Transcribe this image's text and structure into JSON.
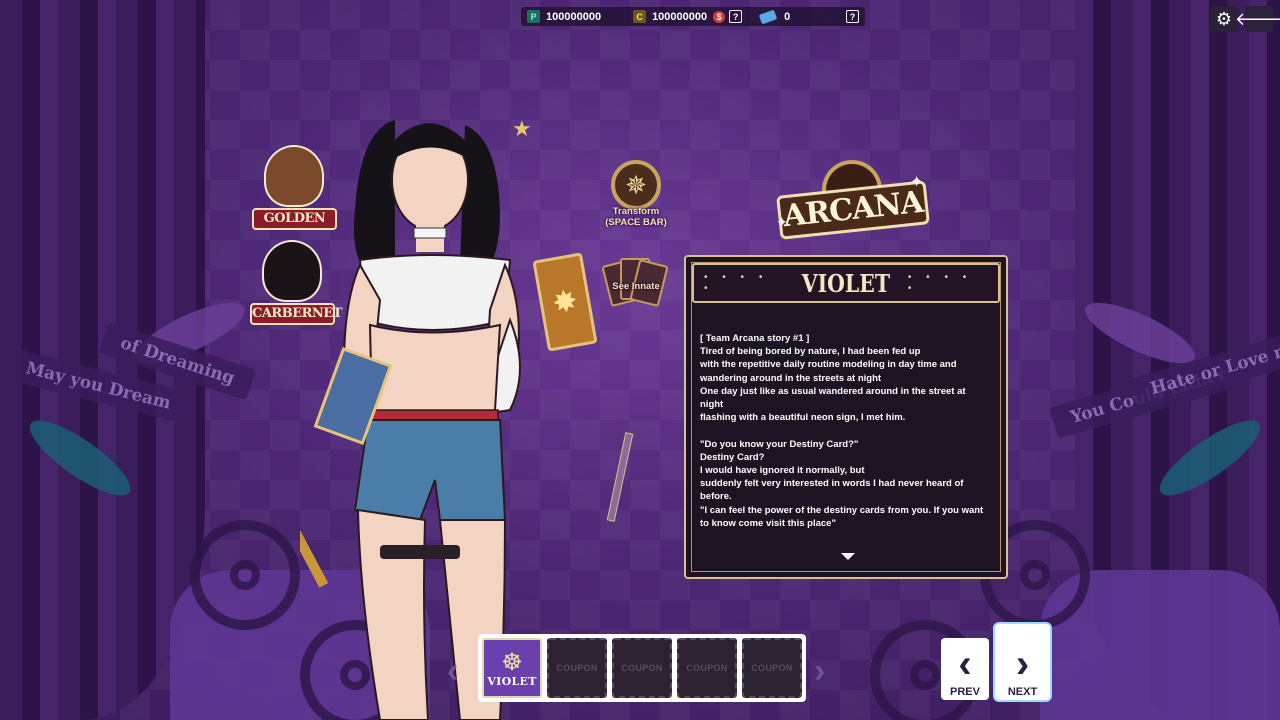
{
  "currency": {
    "p_icon": "P",
    "p_value": "100000000",
    "c_icon": "C",
    "c_value": "100000000",
    "dollar_icon": "$",
    "ticket_value": "0",
    "help_glyph": "?"
  },
  "corner": {
    "settings_icon": "gear-icon",
    "back_icon": "back-arrow-icon",
    "settings_glyph": "⚙",
    "back_glyph": "🡐"
  },
  "portraits": [
    {
      "label": "GOLDEN"
    },
    {
      "label": "CARBERNET"
    }
  ],
  "transform": {
    "label_line1": "Transform",
    "label_line2": "(SPACE BAR)"
  },
  "innate": {
    "label": "See Innate"
  },
  "logo": {
    "text": "ARCANA"
  },
  "banners": {
    "left_1": "of Dreaming",
    "left_2": "May you Dream",
    "right_1": "You Could Either",
    "right_2": "Hate or Love me"
  },
  "panel": {
    "title": "VIOLET",
    "dots": "• • • • •",
    "story": [
      "[ Team Arcana story #1 ]",
      "Tired of being bored by nature, I had been fed up",
      "with the repetitive daily routine modeling in day time and",
      "wandering around in the streets at night",
      "One day just like as usual wandered around in the street at",
      "night",
      "flashing with a beautiful neon sign, I met him.",
      "",
      "\"Do you know your Destiny Card?\"",
      "Destiny Card?",
      "I would have ignored it normally, but",
      "suddenly felt very interested in words I had never heard of",
      "before.",
      "\"I can feel the power of the destiny cards from you. If you want",
      "to know come visit this place\""
    ]
  },
  "slots": [
    {
      "label": "VIOLET",
      "active": true
    },
    {
      "label": "COUPON",
      "active": false
    },
    {
      "label": "COUPON",
      "active": false
    },
    {
      "label": "COUPON",
      "active": false
    },
    {
      "label": "COUPON",
      "active": false
    }
  ],
  "nav": {
    "prev": "PREV",
    "next": "NEXT"
  },
  "colors": {
    "accent_gold": "#d8c092",
    "bg_purple": "#4d2775",
    "tag_red": "#8b1d2b"
  }
}
